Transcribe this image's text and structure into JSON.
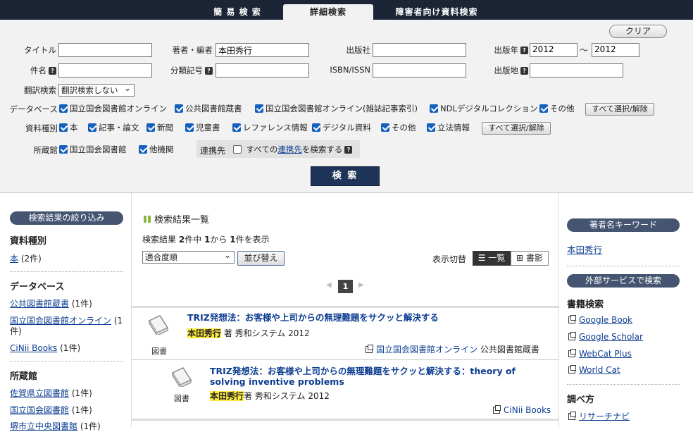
{
  "tabs": {
    "simple": "簡 易 検 索",
    "advanced": "詳細検索",
    "accessible": "障害者向け資料検索"
  },
  "form": {
    "clear": "クリア",
    "title_label": "タイトル",
    "title_value": "",
    "author_label": "著者・編者",
    "author_value": "本田秀行",
    "publisher_label": "出版社",
    "publisher_value": "",
    "year_label": "出版年",
    "year_from": "2012",
    "year_sep": "～",
    "year_to": "2012",
    "subject_label": "件名",
    "subject_value": "",
    "classification_label": "分類記号",
    "classification_value": "",
    "isbn_label": "ISBN/ISSN",
    "isbn_value": "",
    "place_label": "出版地",
    "place_value": "",
    "translation_label": "翻訳検索",
    "translation_value": "翻訳検索しない",
    "database_label": "データベース",
    "databases": [
      "国立国会図書館オンライン",
      "公共図書館蔵書",
      "国立国会図書館オンライン(雑誌記事索引)",
      "NDLデジタルコレクション",
      "その他"
    ],
    "select_all": "すべて選択/解除",
    "type_label": "資料種別",
    "types": [
      "本",
      "記事・論文",
      "新聞",
      "児童書",
      "レファレンス情報",
      "デジタル資料",
      "その他",
      "立法情報"
    ],
    "holding_label": "所蔵館",
    "holdings": [
      "国立国会図書館",
      "他機関"
    ],
    "link_label": "連携先",
    "link_text_a": "すべての",
    "link_text_link": "連携先",
    "link_text_b": "を検索する",
    "search": "検 索"
  },
  "left": {
    "header": "検索結果の絞り込み",
    "sec1": "資料種別",
    "sec1_items": [
      {
        "name": "本",
        "count": "(2件)"
      }
    ],
    "sec2": "データベース",
    "sec2_items": [
      {
        "name": "公共図書館蔵書",
        "count": "(1件)"
      },
      {
        "name": "国立国会図書館オンライン",
        "count": "(1"
      },
      {
        "name": "",
        "count": "件)"
      },
      {
        "name": "CiNii Books",
        "count": "(1件)"
      }
    ],
    "sec3": "所蔵館",
    "sec3_items": [
      {
        "name": "佐賀県立図書館",
        "count": "(1件)"
      },
      {
        "name": "国立国会図書館",
        "count": "(1件)"
      },
      {
        "name": "堺市立中央図書館",
        "count": "(1件)"
      }
    ]
  },
  "center": {
    "heading": "検索結果一覧",
    "summary_a": "検索結果",
    "total": "2",
    "summary_b": "件中",
    "from": "1",
    "summary_c": "から",
    "to": "1",
    "summary_d": "件を表示",
    "sort_value": "適合度順",
    "sort_button": "並び替え",
    "view_label": "表示切替",
    "view_list": "一覧",
    "view_cover": "書影",
    "page": "1",
    "results": [
      {
        "title": "TRIZ発想法：お客様や上司からの無理難題をサクッと解決する",
        "author": "本田秀行",
        "role": " 著",
        "publisher": "秀和システム",
        "year": "2012",
        "type": "図書",
        "sources": [
          "国立国会図書館オンライン",
          "公共図書館蔵書"
        ]
      },
      {
        "title": "TRIZ発想法：お客様や上司からの無理難題をサクッと解決する：theory of solving inventive problems",
        "author": "本田秀行",
        "role": "著",
        "publisher": "秀和システム",
        "year": "2012",
        "type": "図書",
        "sources": [
          "CiNii Books"
        ]
      }
    ]
  },
  "right": {
    "header1": "著者名キーワード",
    "keyword": "本田秀行",
    "header2": "外部サービスで検索",
    "sec1": "書籍検索",
    "services": [
      "Google Book",
      "Google Scholar",
      "WebCat Plus",
      "World Cat"
    ],
    "sec2": "調べ方",
    "guides": [
      "リサーチナビ"
    ]
  },
  "colors": {
    "navy": "#1b2535",
    "pill": "#455571",
    "link": "#0c3d91",
    "highlight": "#ffea3d"
  }
}
